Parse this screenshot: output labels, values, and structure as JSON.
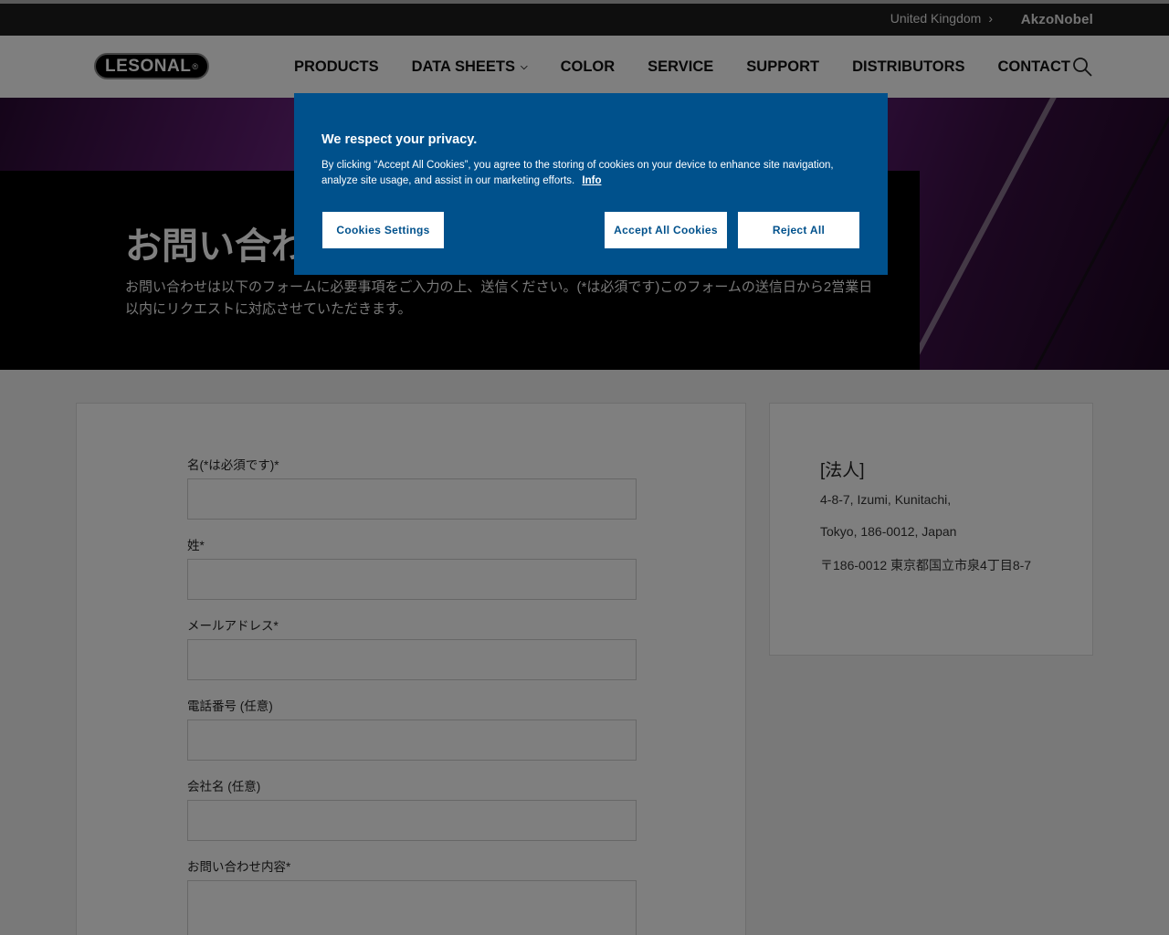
{
  "topbar": {
    "region": "United Kingdom",
    "parent_brand": "AkzoNobel"
  },
  "brand": {
    "logo_text": "LESONAL",
    "logo_mark": "®"
  },
  "nav": {
    "items": [
      {
        "label": "PRODUCTS"
      },
      {
        "label": "DATA SHEETS"
      },
      {
        "label": "COLOR"
      },
      {
        "label": "SERVICE"
      },
      {
        "label": "SUPPORT"
      },
      {
        "label": "DISTRIBUTORS"
      },
      {
        "label": "CONTACT"
      }
    ],
    "search_icon": "search-icon"
  },
  "hero": {
    "title": "お問い合わせ",
    "description": "お問い合わせは以下のフォームに必要事項をご入力の上、送信ください。(*は必須です)このフォームの送信日から2営業日以内にリクエストに対応させていただきます。"
  },
  "form": {
    "fields": [
      {
        "label": "名(*は必須です)*",
        "value": ""
      },
      {
        "label": "姓*",
        "value": ""
      },
      {
        "label": "メールアドレス*",
        "value": ""
      },
      {
        "label": "電話番号 (任意)",
        "value": ""
      },
      {
        "label": "会社名 (任意)",
        "value": ""
      },
      {
        "label": "お問い合わせ内容*",
        "value": ""
      }
    ]
  },
  "address": {
    "title": "[法人]",
    "lines": [
      "4-8-7, Izumi, Kunitachi,",
      "Tokyo, 186-0012, Japan",
      "〒186-0012 東京都国立市泉4丁目8-7"
    ]
  },
  "cookie_banner": {
    "title": "We respect your privacy.",
    "description": "By clicking “Accept All Cookies”, you agree to the storing of cookies on your device to enhance site navigation, analyze site usage, and assist in our marketing efforts.",
    "info_link": "Info",
    "settings_button": "Cookies Settings",
    "accept_button": "Accept All Cookies",
    "reject_button": "Reject All"
  }
}
